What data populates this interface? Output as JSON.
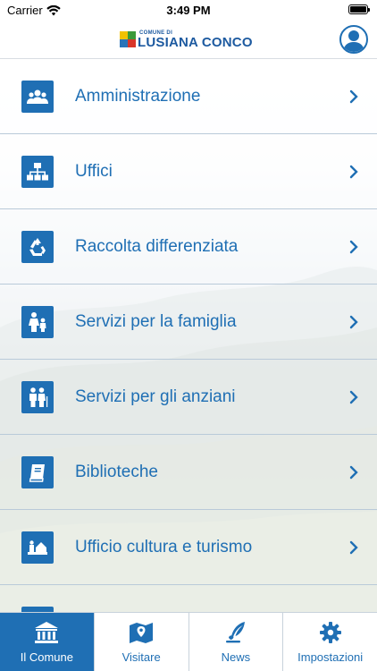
{
  "status_bar": {
    "carrier": "Carrier",
    "time": "3:49 PM"
  },
  "header": {
    "logo_small": "COMUNE DI",
    "logo_big": "LUSIANA CONCO",
    "user_icon": "user-profile-icon"
  },
  "menu": {
    "items": [
      {
        "label": "Amministrazione",
        "icon": "people-group-icon"
      },
      {
        "label": "Uffici",
        "icon": "org-chart-icon"
      },
      {
        "label": "Raccolta differenziata",
        "icon": "recycle-icon"
      },
      {
        "label": "Servizi per la famiglia",
        "icon": "family-icon"
      },
      {
        "label": "Servizi per gli anziani",
        "icon": "elderly-couple-icon"
      },
      {
        "label": "Biblioteche",
        "icon": "book-icon"
      },
      {
        "label": "Ufficio cultura e turismo",
        "icon": "culture-tourism-icon"
      }
    ]
  },
  "tabbar": {
    "tabs": [
      {
        "label": "Il Comune",
        "icon": "town-hall-icon",
        "active": true
      },
      {
        "label": "Visitare",
        "icon": "map-icon",
        "active": false
      },
      {
        "label": "News",
        "icon": "quill-pen-icon",
        "active": false
      },
      {
        "label": "Impostazioni",
        "icon": "gear-icon",
        "active": false
      }
    ]
  },
  "colors": {
    "accent": "#1f6fb4",
    "divider": "#b9cad9",
    "tab_active_bg": "#1f6fb4",
    "tab_active_text": "#ffffff"
  }
}
